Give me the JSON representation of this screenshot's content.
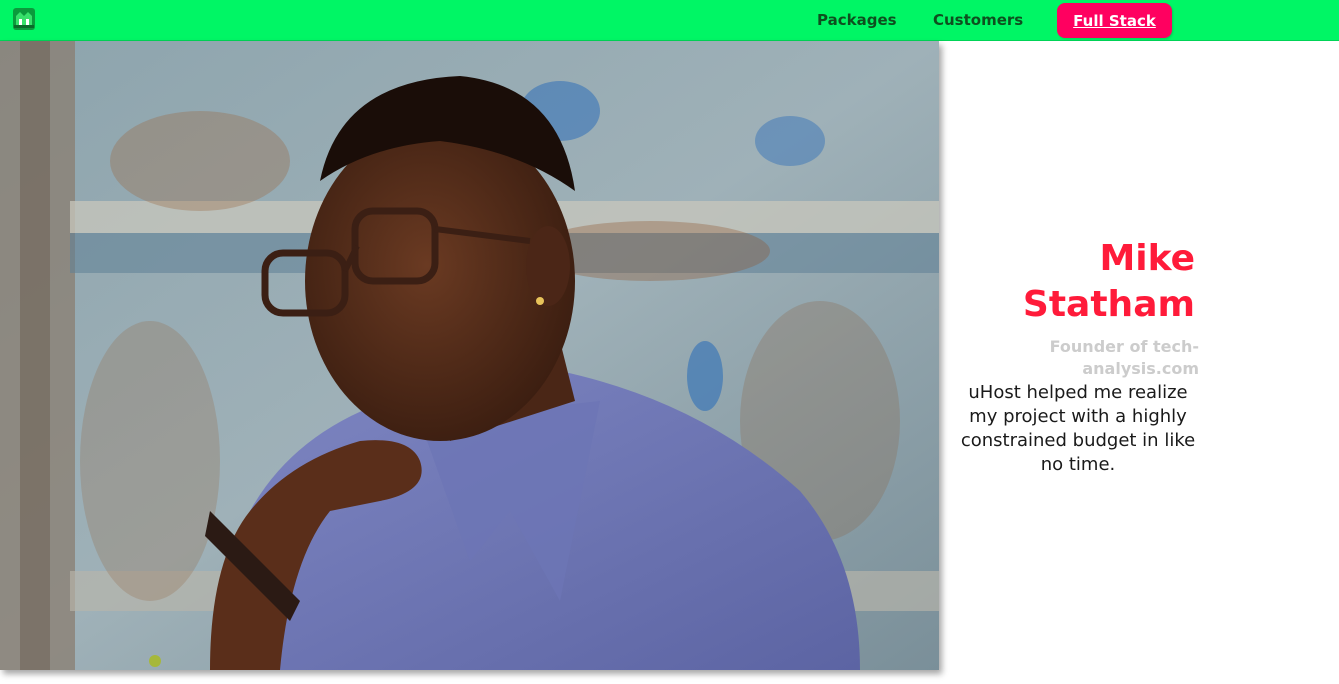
{
  "header": {
    "logo_icon": "uhost-logo-icon",
    "nav": {
      "packages": "Packages",
      "customers": "Customers",
      "cta": "Full Stack"
    },
    "colors": {
      "background": "#00f665",
      "link": "#0e4f1f",
      "cta": "#ff0060"
    }
  },
  "testimonial": {
    "name": "Mike Statham",
    "role": "Founder of tech-analysis.com",
    "quote": "uHost helped me realize my project with a highly constrained budget in like no time.",
    "colors": {
      "name": "#ff1b3a",
      "role": "#cccccc",
      "quote": "#1a1a1a"
    }
  }
}
